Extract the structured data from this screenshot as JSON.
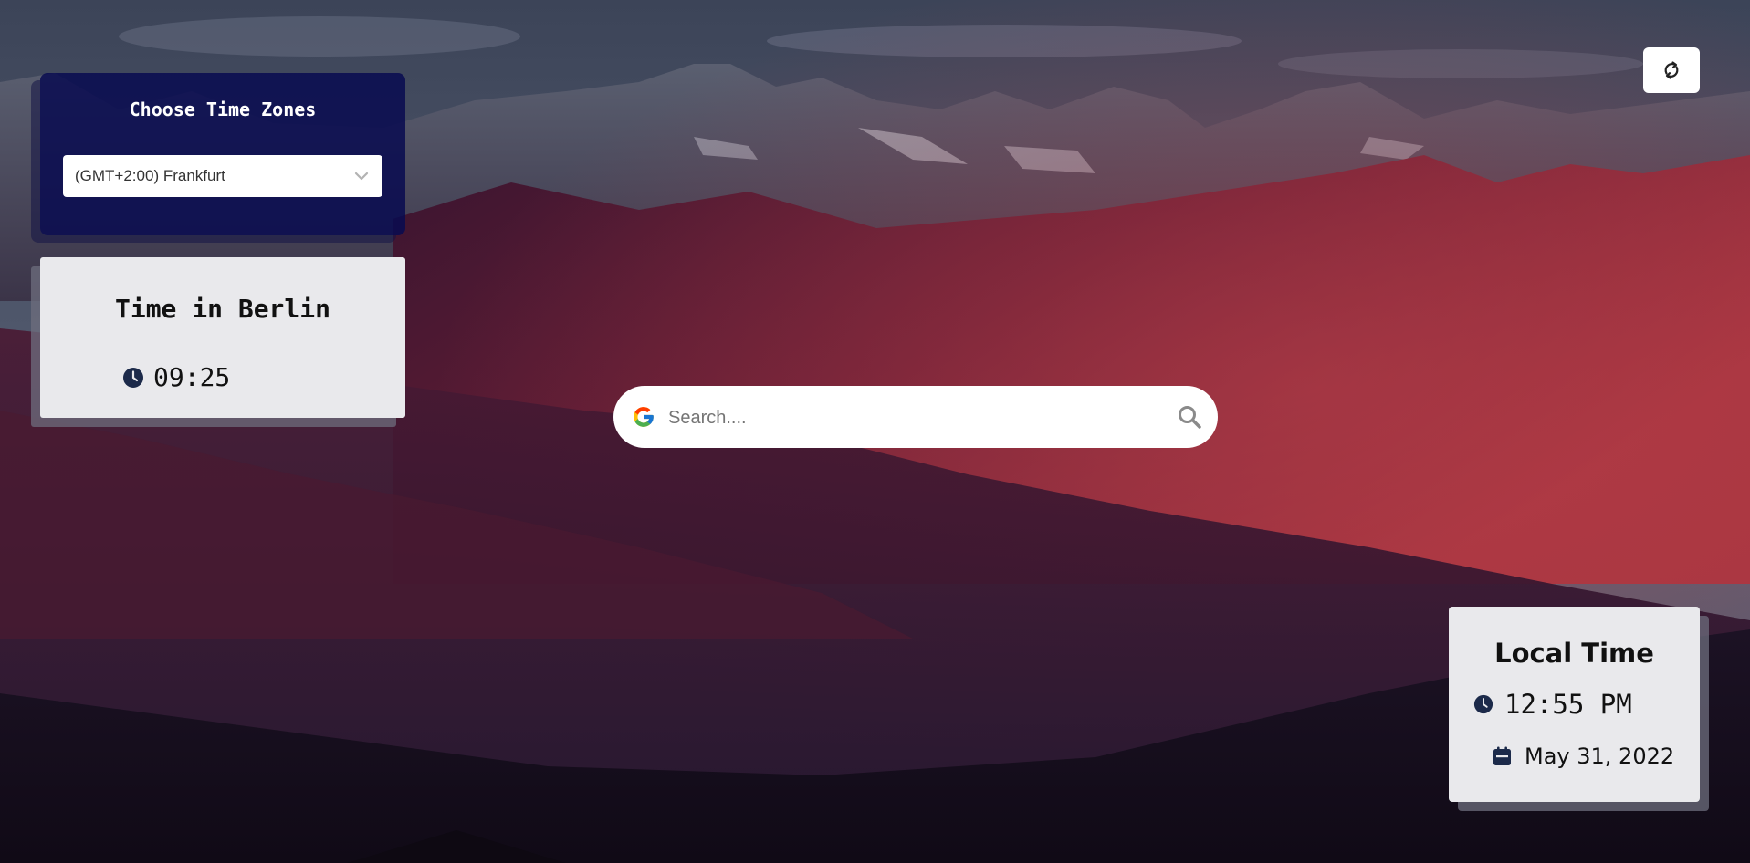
{
  "background": {
    "description_icon": "mountain-landscape-image"
  },
  "timezone_panel": {
    "title": "Choose Time Zones",
    "selected": "(GMT+2:00) Frankfurt",
    "chevron_icon": "chevron-down-icon"
  },
  "city_card": {
    "title": "Time in Berlin",
    "time": "09:25",
    "clock_icon": "clock-icon"
  },
  "search": {
    "placeholder": "Search....",
    "value": "",
    "engine_icon": "google-icon",
    "search_icon": "search-icon"
  },
  "refresh": {
    "icon": "refresh-icon"
  },
  "local_card": {
    "title": "Local Time",
    "time": "12:55 PM",
    "date": "May 31, 2022",
    "clock_icon": "clock-icon",
    "calendar_icon": "calendar-icon"
  },
  "colors": {
    "panel_navy": "#080a50",
    "card_bg": "#e9e9ec",
    "icon_navy": "#1c2a4a",
    "search_bg": "#ffffff"
  }
}
